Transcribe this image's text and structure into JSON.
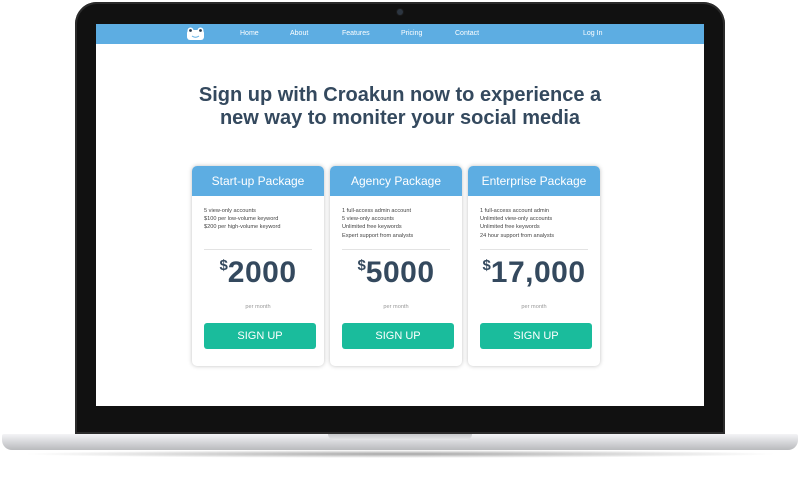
{
  "nav": {
    "logo_icon": "frog-logo-icon",
    "home": "Home",
    "about": "About",
    "features": "Features",
    "pricing": "Pricing",
    "contact": "Contact",
    "login": "Log In"
  },
  "hero": {
    "line1": "Sign up with Croakun now to experience a",
    "line2": "new way to moniter your social media"
  },
  "colors": {
    "brand_blue": "#5dade2",
    "signup_green": "#1abc9c",
    "heading_text": "#34495e"
  },
  "plans": [
    {
      "title": "Start-up Package",
      "features": [
        "5 view-only accounts",
        "$100 per low-volume keyword",
        "$200 per high-volume keyword"
      ],
      "currency": "$",
      "price": "2000",
      "period": "per month",
      "cta": "SIGN UP"
    },
    {
      "title": "Agency Package",
      "features": [
        "1 full-access admin account",
        "5 view-only accounts",
        "Unlimited free keywords",
        "Expert support from analysts"
      ],
      "currency": "$",
      "price": "5000",
      "period": "per month",
      "cta": "SIGN UP"
    },
    {
      "title": "Enterprise Package",
      "features": [
        "1 full-access account admin",
        "Unlimited view-only accounts",
        "Unlimited free keywords",
        "24 hour support from analysts"
      ],
      "currency": "$",
      "price": "17,000",
      "period": "per month",
      "cta": "SIGN UP"
    }
  ]
}
